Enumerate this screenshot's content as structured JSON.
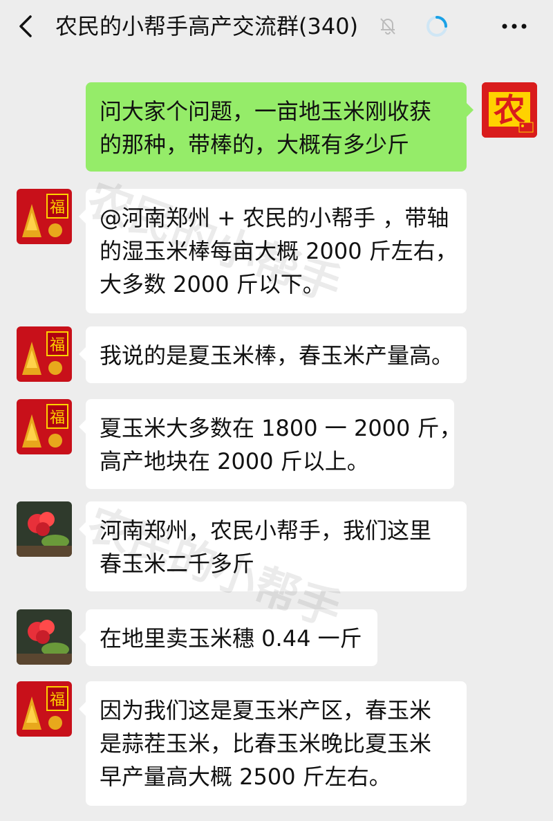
{
  "header": {
    "title": "农民的小帮手高产交流群(340)",
    "back_icon": "chevron-left-icon",
    "mute_icon": "bell-muted-icon",
    "loading_icon": "loading-ring-icon",
    "more_icon": "more-dots-icon"
  },
  "watermark": {
    "text": "农民的小帮手"
  },
  "messages": [
    {
      "side": "right",
      "avatar_text": "农",
      "lines": [
        "问大家个问题，一亩地玉米刚收获",
        "的那种，带棒的，大概有多少斤"
      ]
    },
    {
      "side": "left",
      "avatar_text": "福",
      "lines": [
        "@河南郑州 + 农民的小帮手 ，带轴",
        "的湿玉米棒每亩大概 2000 斤左右，",
        "大多数 2000 斤以下。"
      ]
    },
    {
      "side": "left",
      "avatar_text": "福",
      "lines": [
        "我说的是夏玉米棒，春玉米产量高。"
      ]
    },
    {
      "side": "left",
      "avatar_text": "福",
      "lines": [
        "夏玉米大多数在 1800 一 2000 斤，",
        "高产地块在 2000 斤以上。"
      ]
    },
    {
      "side": "left",
      "avatar_text": "",
      "lines": [
        "河南郑州，农民小帮手，我们这里",
        "春玉米二千多斤"
      ]
    },
    {
      "side": "left",
      "avatar_text": "",
      "lines": [
        "在地里卖玉米穗 0.44 一斤"
      ]
    },
    {
      "side": "left",
      "avatar_text": "福",
      "lines": [
        "因为我们这是夏玉米产区，春玉米",
        "是蒜茬玉米，比春玉米晚比夏玉米",
        "早产量高大概 2500 斤左右。"
      ]
    }
  ],
  "colors": {
    "background": "#ededed",
    "my_bubble": "#95ec69",
    "other_bubble": "#ffffff",
    "avatar_red": "#d91c1c",
    "avatar_yellow": "#ffd200"
  }
}
